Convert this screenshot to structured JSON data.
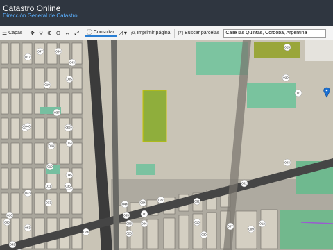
{
  "header": {
    "title": "Catastro Online",
    "subtitle": "Dirección General de Catastro"
  },
  "toolbar": {
    "layers_label": "Capas",
    "consultar_label": "Consultar",
    "print_label": "Imprimir página",
    "search_parcels_label": "Buscar parcelas",
    "search_value": "Calle las Quintas, Córdoba, Argentina"
  },
  "map": {
    "parcel_labels": [
      "001",
      "002",
      "003",
      "004",
      "005",
      "006",
      "007",
      "008",
      "009",
      "010",
      "011",
      "012",
      "013",
      "014",
      "015",
      "016",
      "017",
      "018",
      "019",
      "020",
      "022",
      "023",
      "024",
      "025",
      "026",
      "027",
      "029",
      "030",
      "031",
      "032",
      "033",
      "035",
      "037",
      "039",
      "040",
      "043",
      "044",
      "045",
      "047",
      "049",
      "053",
      "055",
      "063",
      "064",
      "065"
    ],
    "marker_color": "#1a6fd1"
  },
  "colors": {
    "header_bg": "#2f3640",
    "subtitle": "#5bb0ff",
    "green_field": "#7aa83a",
    "teal_field": "#6fc3a0"
  }
}
